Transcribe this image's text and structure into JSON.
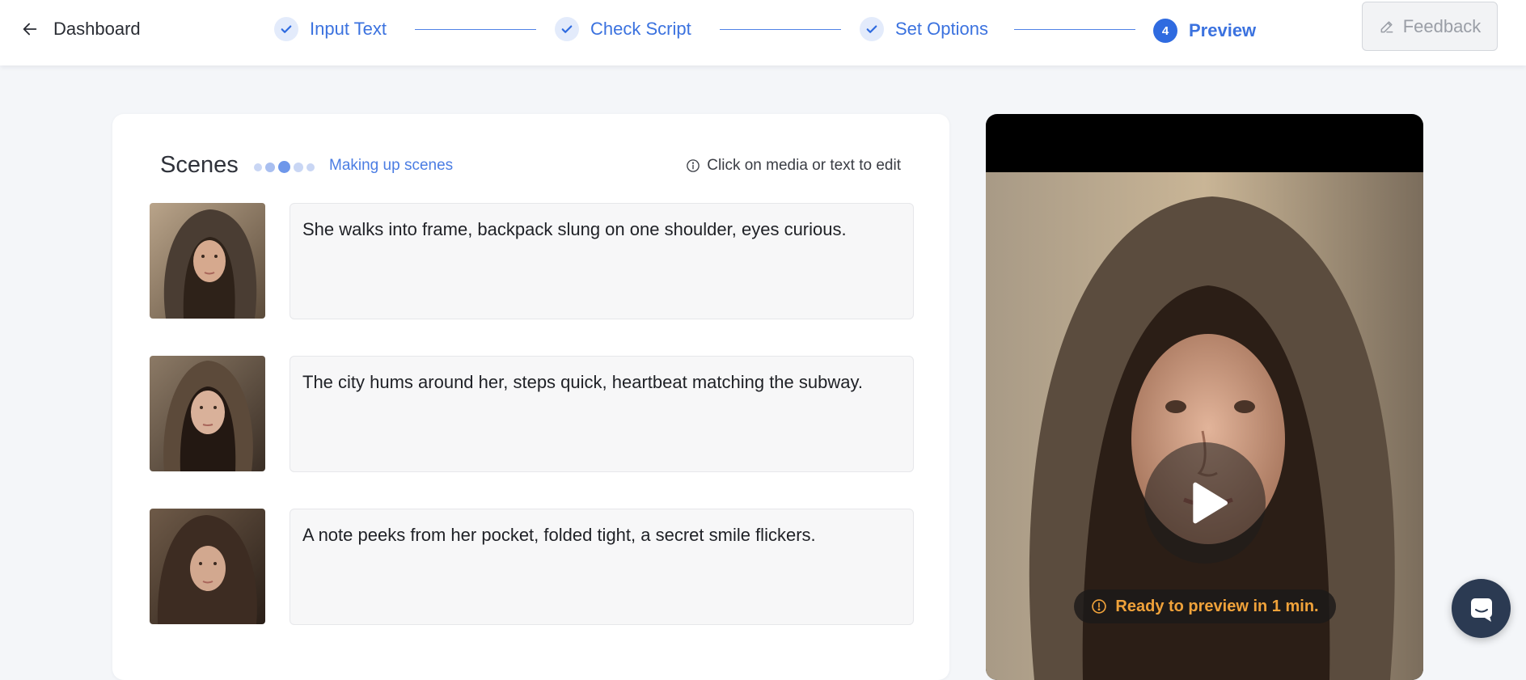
{
  "header": {
    "back_label": "Dashboard",
    "steps": [
      {
        "label": "Input Text",
        "state": "done"
      },
      {
        "label": "Check Script",
        "state": "done"
      },
      {
        "label": "Set Options",
        "state": "done"
      },
      {
        "label": "Preview",
        "state": "current",
        "number": "4"
      }
    ],
    "feedback_label": "Feedback"
  },
  "scenes": {
    "title": "Scenes",
    "status": "Making up scenes",
    "hint": "Click on media or text to edit",
    "items": [
      {
        "text": "She walks into frame, backpack slung on one shoulder, eyes curious."
      },
      {
        "text": "The city hums around her, steps quick, heartbeat matching the subway."
      },
      {
        "text": "A note peeks from her pocket, folded tight, a secret smile flickers."
      }
    ]
  },
  "preview": {
    "ready_text": "Ready to preview in 1 min."
  },
  "icons": {
    "back": "arrow-left-icon",
    "step_done": "check-icon",
    "feedback": "pencil-icon",
    "hint": "info-icon",
    "play": "play-icon",
    "ready": "info-icon",
    "chat": "chat-icon"
  },
  "colors": {
    "accent": "#2f6be0",
    "step_text": "#3b72df",
    "warning": "#f0a23a",
    "chat_bg": "#2b3a52"
  }
}
